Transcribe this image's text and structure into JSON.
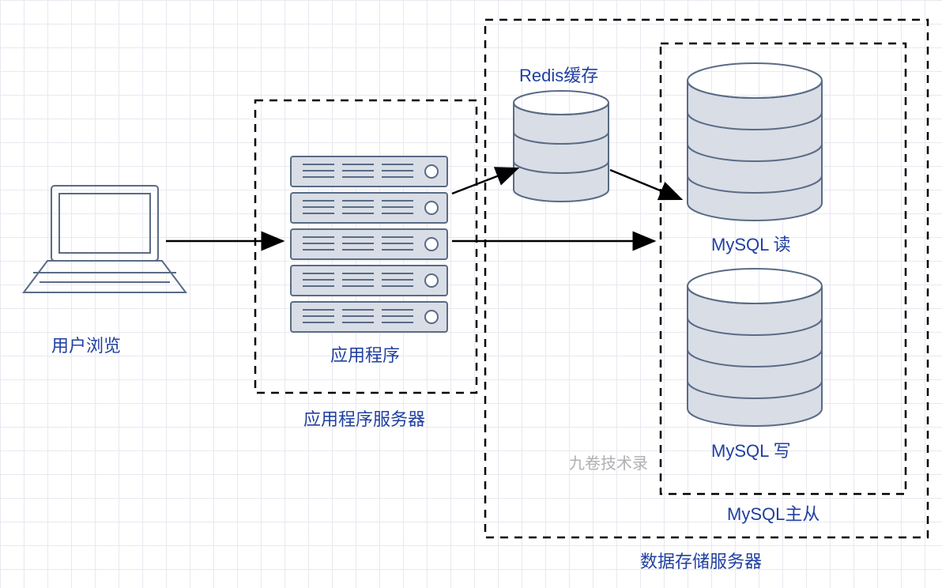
{
  "labels": {
    "user_browse": "用户浏览",
    "app_program": "应用程序",
    "app_server_box": "应用程序服务器",
    "redis": "Redis缓存",
    "mysql_read": "MySQL 读",
    "mysql_write": "MySQL 写",
    "mysql_master_slave": "MySQL主从",
    "data_storage_box": "数据存储服务器",
    "watermark": "九卷技术录"
  },
  "colors": {
    "text": "#2040a0",
    "shape_fill": "#d8dde6",
    "shape_stroke": "#5a6b85",
    "arrow": "#000000",
    "grid": "#e8e8f0"
  },
  "diagram": {
    "nodes": [
      {
        "id": "browser",
        "type": "laptop",
        "label_key": "user_browse"
      },
      {
        "id": "app_server",
        "type": "server",
        "label_key": "app_program",
        "container_label_key": "app_server_box"
      },
      {
        "id": "redis",
        "type": "cylinder",
        "label_key": "redis"
      },
      {
        "id": "mysql_read",
        "type": "cylinder",
        "label_key": "mysql_read"
      },
      {
        "id": "mysql_write",
        "type": "cylinder",
        "label_key": "mysql_write"
      },
      {
        "id": "mysql_cluster",
        "type": "container",
        "label_key": "mysql_master_slave",
        "children": [
          "mysql_read",
          "mysql_write"
        ]
      },
      {
        "id": "data_store",
        "type": "container",
        "label_key": "data_storage_box",
        "children": [
          "redis",
          "mysql_cluster"
        ]
      }
    ],
    "edges": [
      {
        "from": "browser",
        "to": "app_server"
      },
      {
        "from": "app_server",
        "to": "redis"
      },
      {
        "from": "app_server",
        "to": "mysql_read"
      },
      {
        "from": "redis",
        "to": "mysql_read"
      }
    ]
  }
}
